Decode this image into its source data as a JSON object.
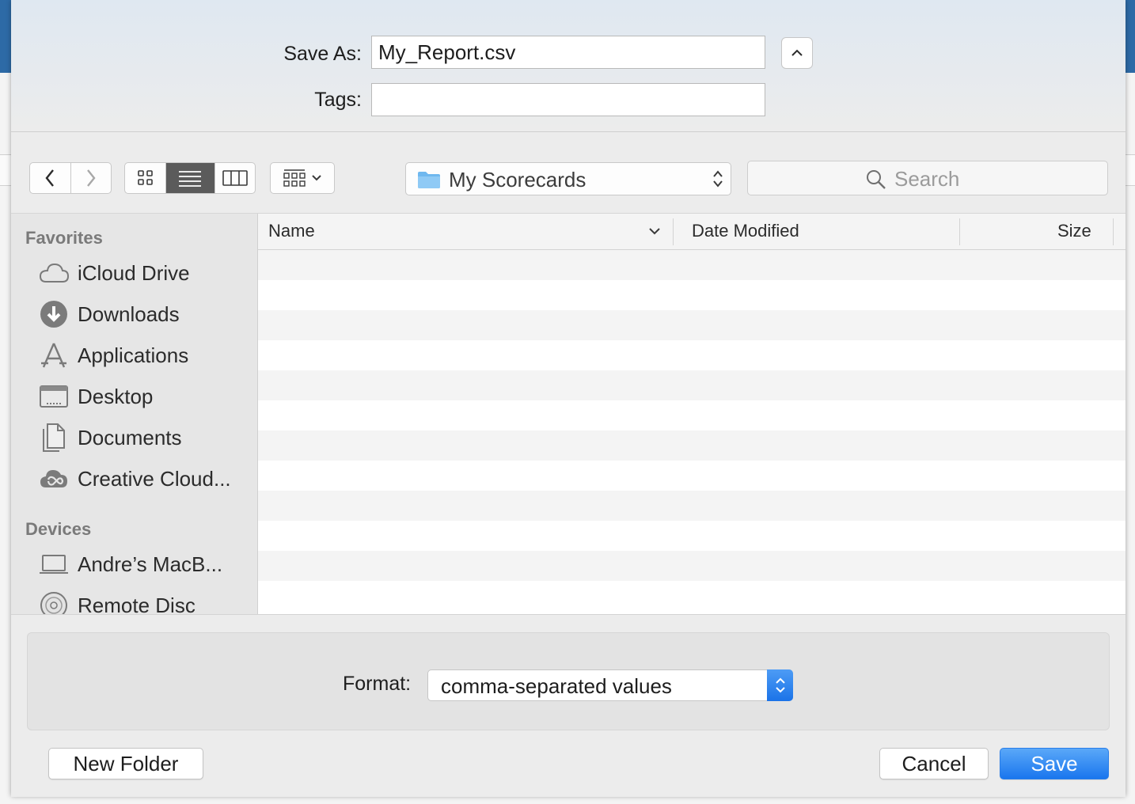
{
  "dialog": {
    "save_as_label": "Save As:",
    "save_as_value": "My_Report.csv",
    "tags_label": "Tags:",
    "tags_value": ""
  },
  "toolbar": {
    "location": "My Scorecards",
    "search_placeholder": "Search"
  },
  "sidebar": {
    "sections": [
      {
        "heading": "Favorites",
        "items": [
          {
            "label": "iCloud Drive",
            "icon": "cloud-icon"
          },
          {
            "label": "Downloads",
            "icon": "downloads-icon"
          },
          {
            "label": "Applications",
            "icon": "applications-icon"
          },
          {
            "label": "Desktop",
            "icon": "desktop-icon"
          },
          {
            "label": "Documents",
            "icon": "documents-icon"
          },
          {
            "label": "Creative Cloud...",
            "icon": "creative-cloud-icon"
          }
        ]
      },
      {
        "heading": "Devices",
        "items": [
          {
            "label": "Andre’s MacB...",
            "icon": "laptop-icon"
          },
          {
            "label": "Remote Disc",
            "icon": "disc-icon"
          }
        ]
      }
    ]
  },
  "file_list": {
    "columns": [
      "Name",
      "Date Modified",
      "Size"
    ]
  },
  "format": {
    "label": "Format:",
    "value": "comma-separated values"
  },
  "buttons": {
    "new_folder": "New Folder",
    "cancel": "Cancel",
    "save": "Save"
  },
  "colors": {
    "accent": "#1a76ee",
    "sidebar_bg": "#e6e6e6"
  }
}
